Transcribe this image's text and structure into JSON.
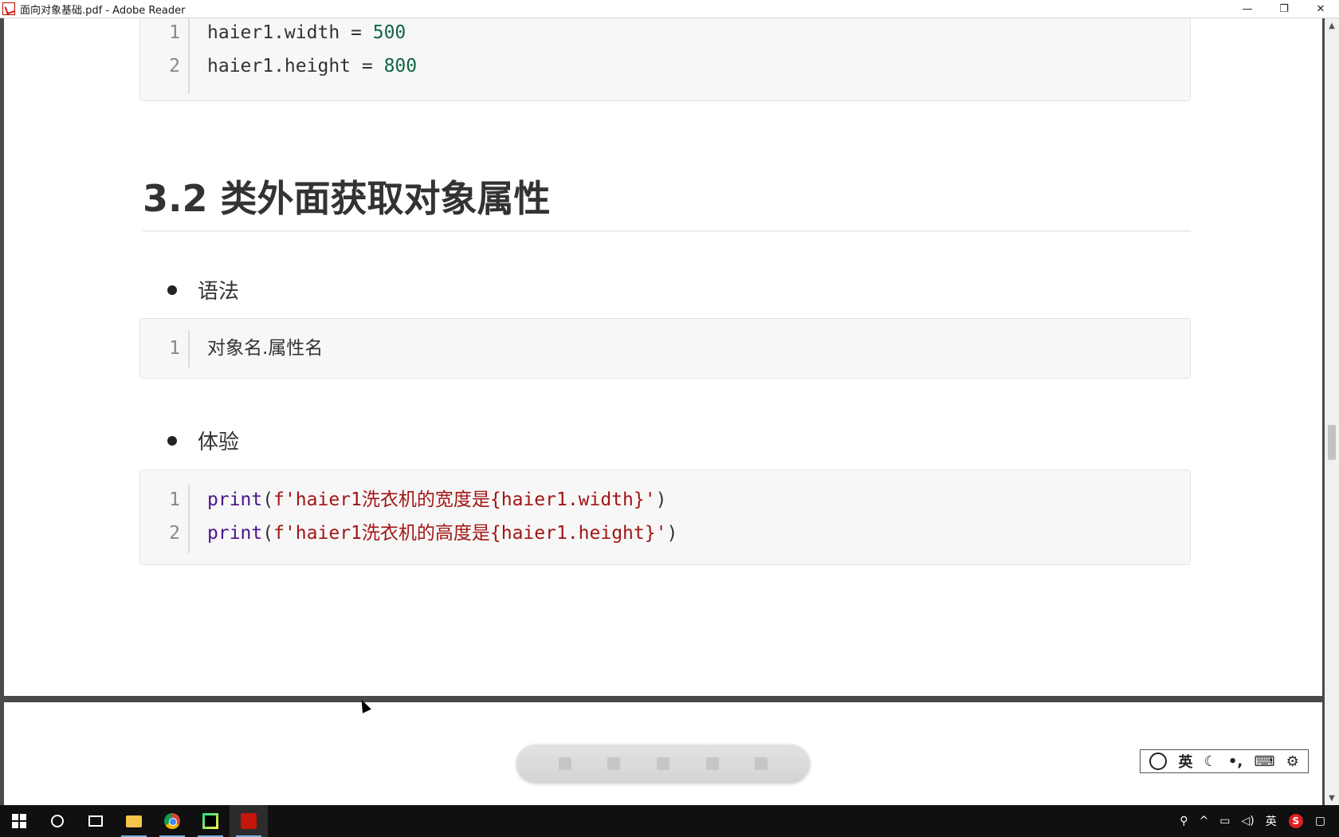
{
  "window": {
    "title": "面向对象基础.pdf - Adobe Reader",
    "minimize": "—",
    "restore": "❐",
    "close": "✕"
  },
  "document": {
    "top_code": {
      "lines": [
        {
          "num": "1",
          "text": "haier1.width = ",
          "value": "500"
        },
        {
          "num": "2",
          "text": "haier1.height = ",
          "value": "800"
        }
      ]
    },
    "section_heading": "3.2 类外面获取对象属性",
    "bullet_syntax": "语法",
    "syntax_code": {
      "lines": [
        {
          "num": "1",
          "text": "对象名.属性名"
        }
      ]
    },
    "bullet_experience": "体验",
    "experience_code": {
      "lines": [
        {
          "num": "1",
          "keyword": "print",
          "open": "(",
          "string": "f'haier1洗衣机的宽度是{haier1.width}'",
          "close": ")"
        },
        {
          "num": "2",
          "keyword": "print",
          "open": "(",
          "string": "f'haier1洗衣机的高度是{haier1.height}'",
          "close": ")"
        }
      ]
    }
  },
  "ime": {
    "mode": "英",
    "moon": "☾",
    "punct": "•,",
    "keyboard": "⌨",
    "settings": "⚙"
  },
  "taskbar": {
    "tray_lang": "英",
    "tray_s": "S"
  },
  "colors": {
    "keyword": "#4a148c",
    "string": "#a31515",
    "number": "#116644"
  }
}
